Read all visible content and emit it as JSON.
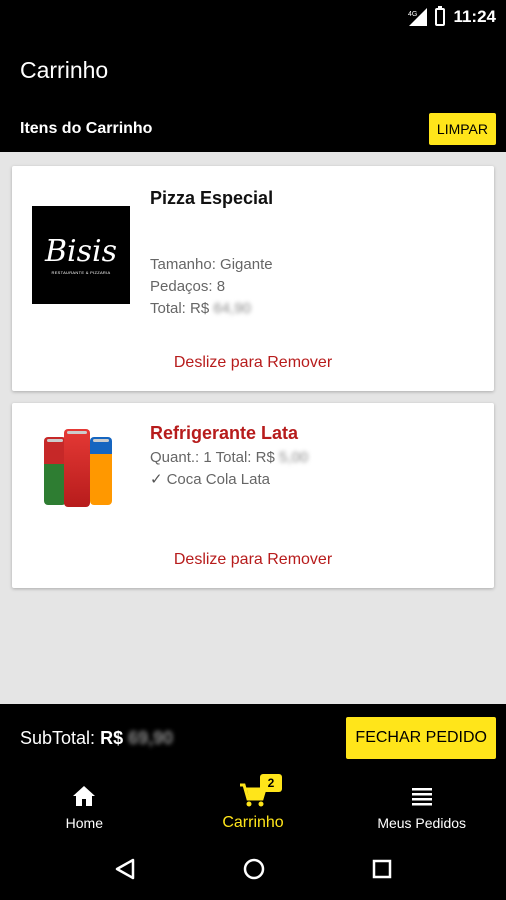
{
  "status": {
    "time": "11:24",
    "network": "4G"
  },
  "app_bar": {
    "title": "Carrinho"
  },
  "sub_bar": {
    "title": "Itens do Carrinho",
    "clear_label": "LIMPAR"
  },
  "items": [
    {
      "title": "Pizza Especial",
      "logo_text": "Bisis",
      "logo_sub": "RESTAURANTE & PIZZARIA",
      "size": "Tamanho: Gigante",
      "slices": "Pedaços: 8",
      "total_label": "Total: R$",
      "total_value": "64,90",
      "swipe": "Deslize para Remover"
    },
    {
      "title": "Refrigerante Lata",
      "qty_total_label": "Quant.: 1 Total: R$",
      "total_value": "5,00",
      "option": "Coca Cola Lata",
      "swipe": "Deslize para Remover"
    }
  ],
  "footer": {
    "subtotal_label": "SubTotal:",
    "currency": "R$",
    "subtotal_value": "69,90",
    "checkout_label": "FECHAR PEDIDO"
  },
  "nav": [
    {
      "label": "Home",
      "icon": "home-icon"
    },
    {
      "label": "Carrinho",
      "icon": "cart-icon",
      "badge": "2",
      "active": true
    },
    {
      "label": "Meus Pedidos",
      "icon": "list-icon"
    }
  ],
  "colors": {
    "accent": "#ffe51a",
    "danger": "#b71c1c",
    "background": "#e5e5e5"
  }
}
